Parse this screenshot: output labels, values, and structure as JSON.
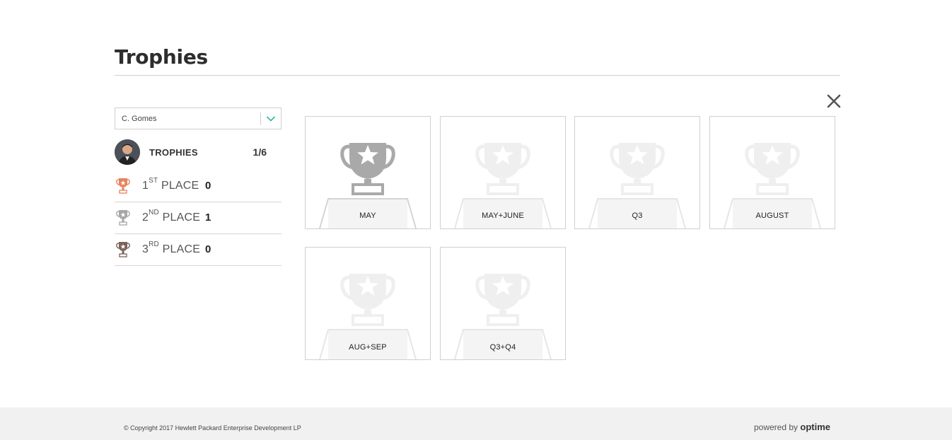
{
  "page": {
    "title": "Trophies"
  },
  "filter": {
    "selected_user": "C. Gomes"
  },
  "summary": {
    "label": "TROPHIES",
    "count": "1/6"
  },
  "places": [
    {
      "num": "1",
      "suffix": "ST",
      "word": "PLACE",
      "value": "0",
      "color": "#e8825f"
    },
    {
      "num": "2",
      "suffix": "ND",
      "word": "PLACE",
      "value": "1",
      "color": "#a6a6a6"
    },
    {
      "num": "3",
      "suffix": "RD",
      "word": "PLACE",
      "value": "0",
      "color": "#7a6358"
    }
  ],
  "trophies": [
    {
      "label": "MAY",
      "earned": true
    },
    {
      "label": "MAY+JUNE",
      "earned": false
    },
    {
      "label": "Q3",
      "earned": false
    },
    {
      "label": "AUGUST",
      "earned": false
    },
    {
      "label": "AUG+SEP",
      "earned": false
    },
    {
      "label": "Q3+Q4",
      "earned": false
    }
  ],
  "colors": {
    "accent": "#2eb5a3",
    "earned_trophy": "#a9a9a9",
    "unearned_trophy": "#efefef"
  },
  "footer": {
    "copyright": "© Copyright 2017 Hewlett Packard Enterprise Development LP",
    "powered_prefix": "powered by",
    "powered_brand": "optime"
  }
}
